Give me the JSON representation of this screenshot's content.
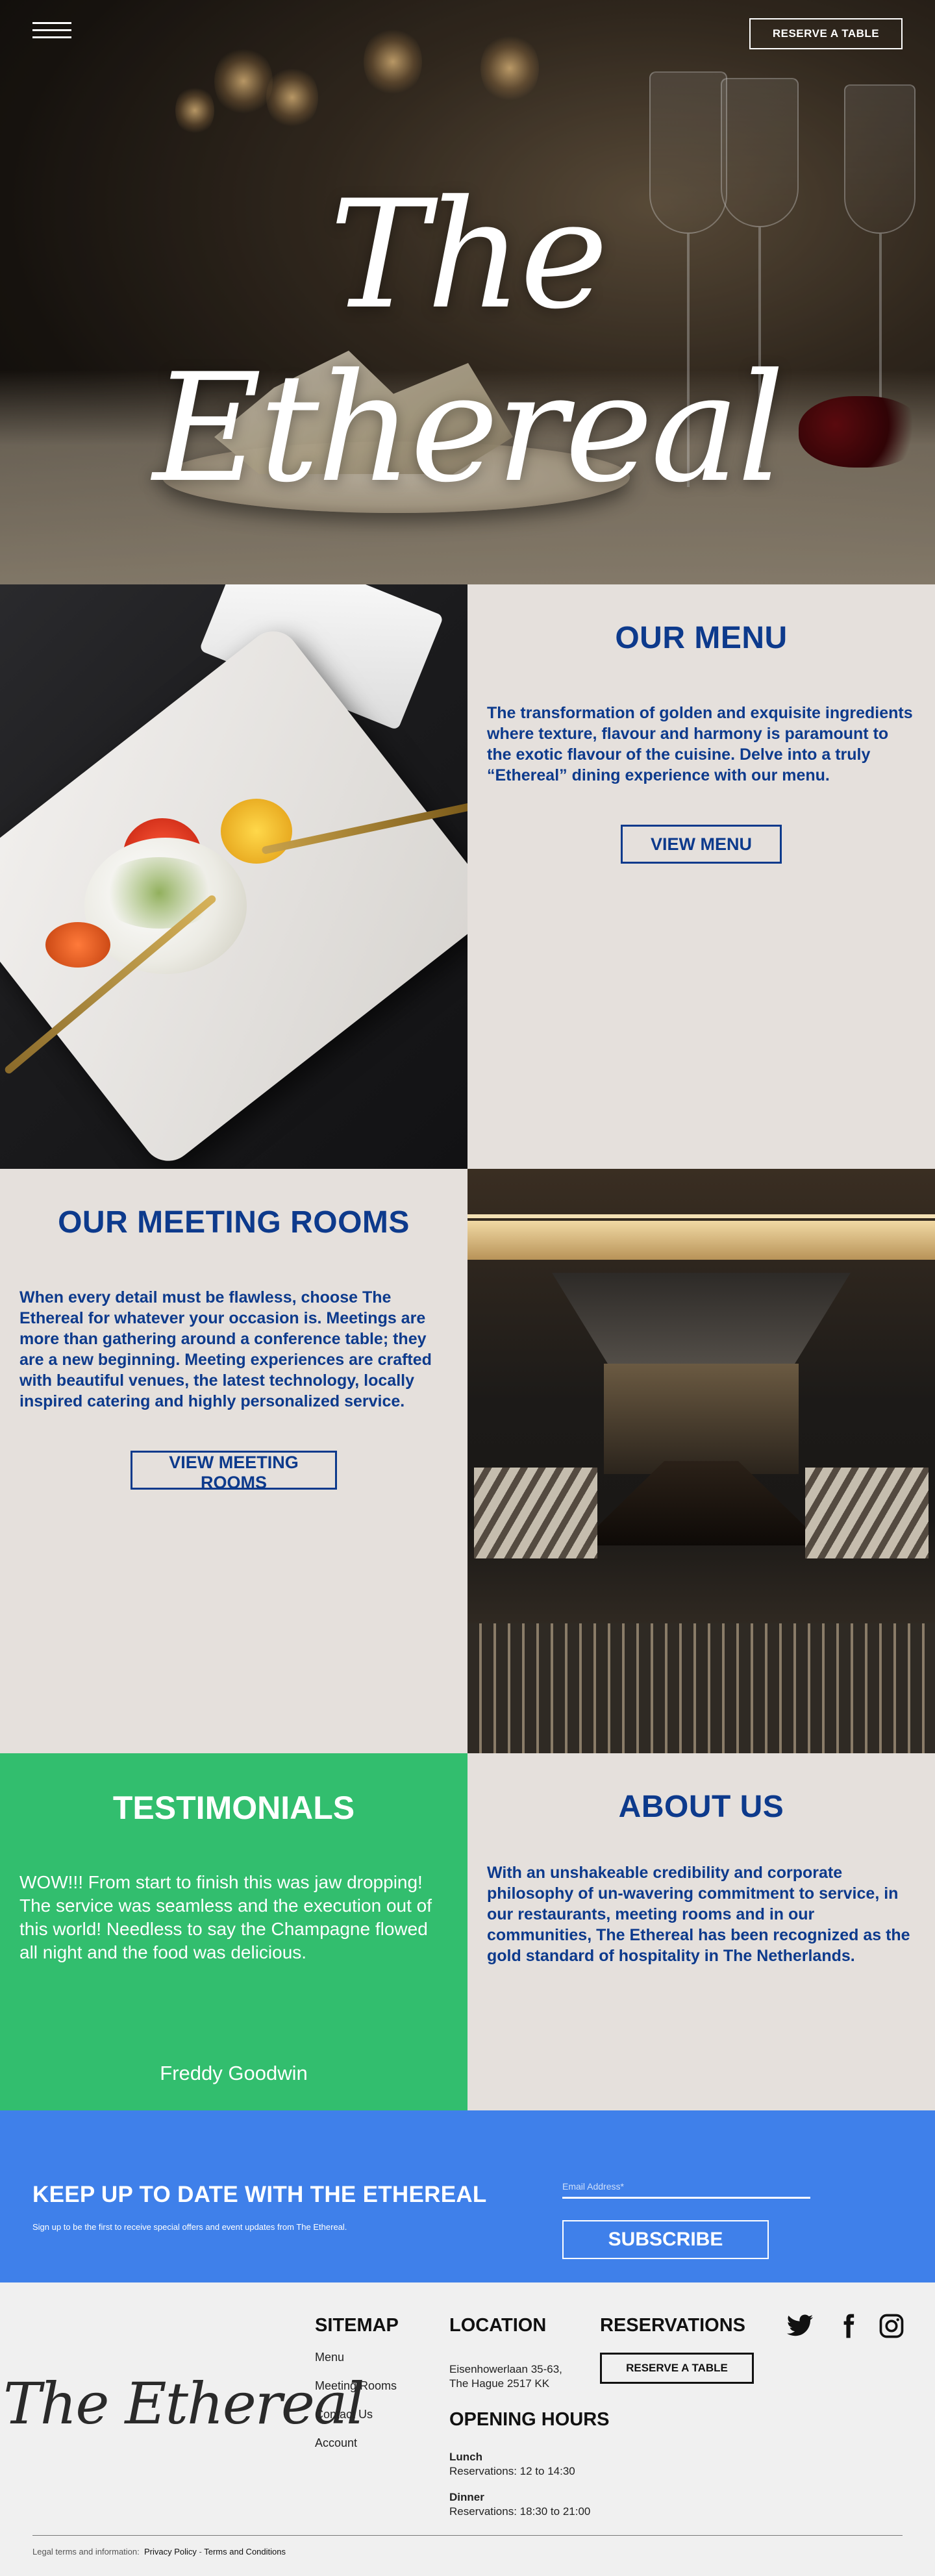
{
  "hero": {
    "title": "The Ethereal",
    "reserve_label": "RESERVE A TABLE"
  },
  "menu_section": {
    "heading": "OUR MENU",
    "body": "The transformation of golden and exquisite ingredients where texture, flavour and harmony is paramount to the exotic flavour of the cuisine. Delve into a truly “Ethereal” dining experience with our menu.",
    "button_label": "VIEW MENU"
  },
  "meeting_section": {
    "heading": "OUR MEETING ROOMS",
    "body": "When every detail must be flawless, choose The Ethereal for whatever your occasion is. Meetings are more than gathering around a conference table; they are a new beginning. Meeting experiences are crafted with beautiful venues, the latest technology, locally inspired catering and highly personalized service.",
    "button_label": "VIEW MEETING ROOMS"
  },
  "testimonials": {
    "heading": "TESTIMONIALS",
    "quote": "WOW!!! From start to finish this was jaw dropping! The service was seamless and the execution out of this world! Needless to say the Champagne flowed all night and the food was delicious.",
    "author": "Freddy Goodwin",
    "slide_count": 5,
    "active_slide": 1
  },
  "about": {
    "heading": "ABOUT US",
    "body": "With an unshakeable credibility and corporate philosophy of un-wavering commitment to service, in our restaurants, meeting rooms and in our communities, The Ethereal has been recognized as the gold standard of hospitality in The Netherlands."
  },
  "newsletter": {
    "heading": "KEEP UP TO DATE WITH THE ETHEREAL",
    "subtext": "Sign up to be the first to receive special offers and event updates from The Ethereal.",
    "email_placeholder": "Email Address*",
    "subscribe_label": "SUBSCRIBE"
  },
  "footer": {
    "logo": "The Ethereal",
    "sitemap": {
      "heading": "SITEMAP",
      "links": [
        "Menu",
        "Meeting Rooms",
        "Contact Us",
        "Account"
      ]
    },
    "location": {
      "heading": "LOCATION",
      "address_line1": "Eisenhowerlaan 35-63,",
      "address_line2": "The Hague 2517 KK"
    },
    "reservations": {
      "heading": "RESERVATIONS",
      "button_label": "RESERVE A TABLE"
    },
    "hours": {
      "heading": "OPENING HOURS",
      "lunch_label": "Lunch",
      "lunch_time": "Reservations: 12 to 14:30",
      "dinner_label": "Dinner",
      "dinner_time": "Reservations: 18:30 to 21:00"
    },
    "social_icons": [
      "twitter-icon",
      "facebook-icon",
      "instagram-icon"
    ],
    "legal": {
      "prefix": "Legal terms and information:",
      "privacy": "Privacy Policy",
      "separator": " - ",
      "terms": "Terms and Conditions"
    }
  },
  "colors": {
    "brand_blue": "#0d3a8c",
    "panel_beige": "#e5e0dc",
    "testimonial_green": "#32be6e",
    "newsletter_blue": "#3f80ea",
    "footer_bg": "#f0f0f0"
  }
}
